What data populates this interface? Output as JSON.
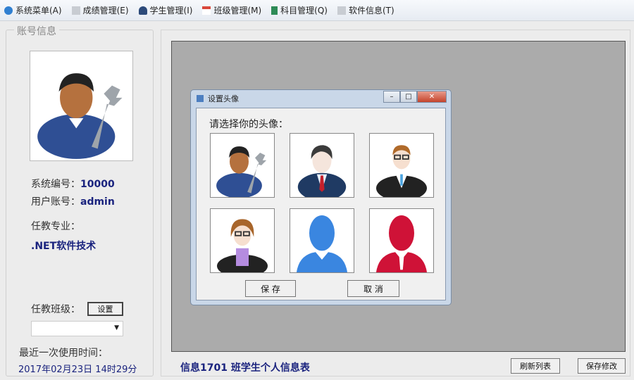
{
  "menu": [
    {
      "label": "系统菜单(A)",
      "icon": "system-icon",
      "color": "#2f7fd1"
    },
    {
      "label": "成绩管理(E)",
      "icon": "document-icon",
      "color": "#c8ccd2"
    },
    {
      "label": "学生管理(I)",
      "icon": "user-icon",
      "color": "#2c4a7a"
    },
    {
      "label": "班级管理(M)",
      "icon": "calendar-icon",
      "color": "#d9473b"
    },
    {
      "label": "科目管理(Q)",
      "icon": "book-icon",
      "color": "#2e8b57"
    },
    {
      "label": "软件信息(T)",
      "icon": "info-icon",
      "color": "#c8ccd2"
    }
  ],
  "account": {
    "group_title": "账号信息",
    "id_label": "系统编号：",
    "id_value": "10000",
    "user_label": "用户账号：",
    "user_value": "admin",
    "major_label": "任教专业：",
    "major_value": ".NET软件技术",
    "class_label": "任教班级：",
    "set_button": "设置",
    "class_select": "",
    "last_used_label": "最近一次使用时间：",
    "last_used_value": "2017年02月23日 14时29分"
  },
  "main": {
    "table_title": "信息1701 班学生个人信息表",
    "refresh_button": "刷新列表",
    "save_changes_button": "保存修改"
  },
  "dialog": {
    "title": "设置头像",
    "prompt": "请选择你的头像：",
    "save_button": "保 存",
    "cancel_button": "取 消",
    "avatars": [
      "engineer",
      "businessman",
      "man-glasses",
      "woman-glasses",
      "blue-silhouette",
      "red-silhouette"
    ]
  }
}
